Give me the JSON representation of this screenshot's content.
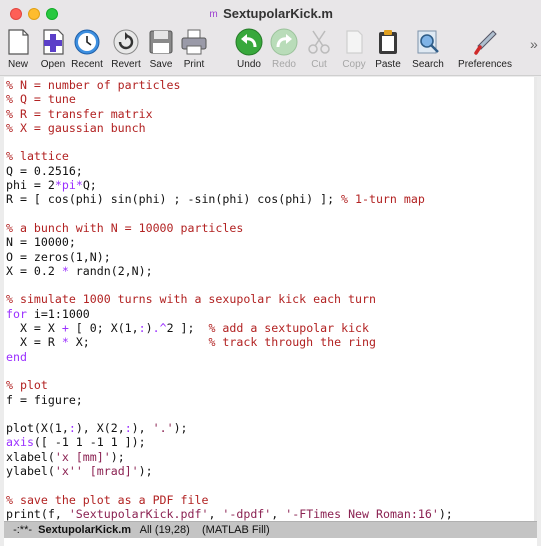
{
  "window": {
    "title": "SextupolarKick.m"
  },
  "toolbar": {
    "items": [
      {
        "label": "New",
        "icon": "new-file-icon",
        "enabled": true
      },
      {
        "label": "Open",
        "icon": "open-file-icon",
        "enabled": true
      },
      {
        "label": "Recent",
        "icon": "recent-clock-icon",
        "enabled": true
      },
      {
        "label": "Revert",
        "icon": "revert-icon",
        "enabled": true
      },
      {
        "label": "Save",
        "icon": "save-disk-icon",
        "enabled": true
      },
      {
        "label": "Print",
        "icon": "printer-icon",
        "enabled": true
      },
      {
        "label": "Undo",
        "icon": "undo-icon",
        "enabled": true
      },
      {
        "label": "Redo",
        "icon": "redo-icon",
        "enabled": false
      },
      {
        "label": "Cut",
        "icon": "scissors-icon",
        "enabled": false
      },
      {
        "label": "Copy",
        "icon": "copy-icon",
        "enabled": false
      },
      {
        "label": "Paste",
        "icon": "clipboard-icon",
        "enabled": true
      },
      {
        "label": "Search",
        "icon": "search-icon",
        "enabled": true
      },
      {
        "label": "Preferences",
        "icon": "wrench-icon",
        "enabled": true
      }
    ],
    "more": "»"
  },
  "editor": {
    "lines": [
      "% N = number of particles",
      "% Q = tune",
      "% R = transfer matrix",
      "% X = gaussian bunch",
      "",
      "% lattice",
      "Q = 0.2516;",
      "phi = 2*pi*Q;",
      "R = [ cos(phi) sin(phi) ; -sin(phi) cos(phi) ]; % 1-turn map",
      "",
      "% a bunch with N = 10000 particles",
      "N = 10000;",
      "O = zeros(1,N);",
      "X = 0.2 * randn(2,N);",
      "",
      "% simulate 1000 turns with a sexupolar kick each turn",
      "for i=1:1000",
      "  X = X + [ 0; X(1,:).^2 ];  % add a sextupolar kick",
      "  X = R * X;                 % track through the ring",
      "end",
      "",
      "% plot",
      "f = figure;",
      "",
      "plot(X(1,:), X(2,:), '.');",
      "axis([ -1 1 -1 1 ]);",
      "xlabel('x [mm]');",
      "ylabel('x'' [mrad]');",
      "",
      "% save the plot as a PDF file",
      "print(f, 'SextupolarKick.pdf', '-dpdf', '-FTimes New Roman:16');"
    ]
  },
  "modeline": {
    "status": "-:**-",
    "buffer": "SextupolarKick.m",
    "position": "All (19,28)",
    "mode": "(MATLAB Fill)"
  },
  "colors": {
    "comment": "#b22222",
    "keyword": "#9b30ff",
    "string": "#8b2252",
    "close": "#fe5f57",
    "minimize": "#febc2e",
    "maximize": "#28c840"
  }
}
